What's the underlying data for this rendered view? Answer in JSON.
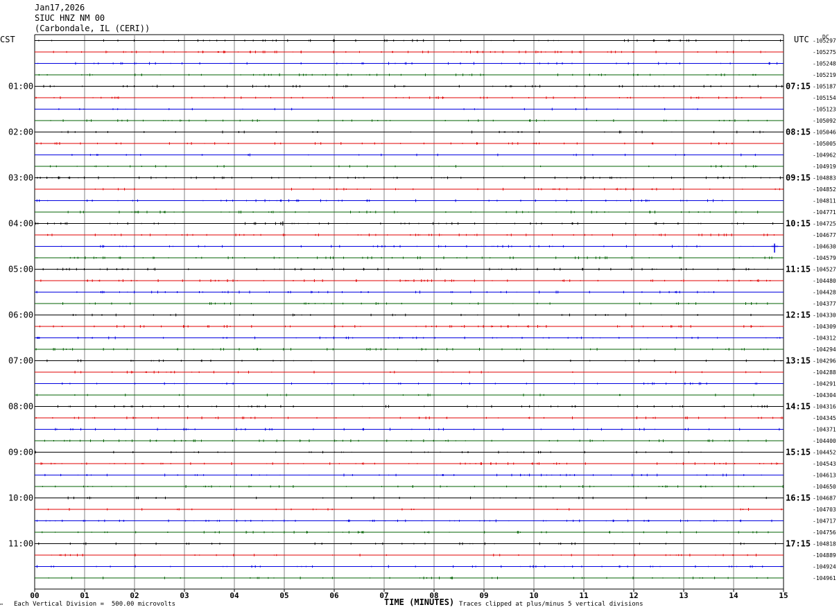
{
  "header": {
    "date": "Jan17,2026",
    "station": "SIUC HNZ NM 00",
    "location": "(Carbondale, IL (CERI))"
  },
  "axis": {
    "left_zone": "CST",
    "right_zone": "UTC",
    "dc_label": "DC",
    "xlabel": "TIME (MINUTES)",
    "x_ticks": [
      "00",
      "01",
      "02",
      "03",
      "04",
      "05",
      "06",
      "07",
      "08",
      "09",
      "10",
      "11",
      "12",
      "13",
      "14",
      "15"
    ],
    "left_hour_labels": [
      "01:00",
      "02:00",
      "03:00",
      "04:00",
      "05:00",
      "06:00",
      "07:00",
      "08:00",
      "09:00",
      "10:00",
      "11:00"
    ],
    "right_hour_labels": [
      "07:15",
      "08:15",
      "09:15",
      "10:15",
      "11:15",
      "12:15",
      "13:15",
      "14:15",
      "15:15",
      "16:15",
      "17:15"
    ]
  },
  "footer": {
    "scale_note": "Each Vertical Division =  500.00 microvolts",
    "clip_note": "Traces clipped at plus/minus 5 vertical divisions",
    "corner_mark": "™"
  },
  "colors": {
    "trace_cycle": [
      "#000000",
      "#e00000",
      "#0000e0",
      "#006000"
    ],
    "grid": "#808080"
  },
  "chart_data": {
    "type": "line",
    "title": "",
    "xlim": [
      0,
      15
    ],
    "trace_count": 48,
    "minutes_per_trace": 15,
    "dc_offsets": [
      "-105297",
      "-105275",
      "-105248",
      "-105219",
      "-105187",
      "-105154",
      "-105123",
      "-105092",
      "-105046",
      "-105005",
      "-104962",
      "-104919",
      "-104883",
      "-104852",
      "-104811",
      "-104771",
      "-104725",
      "-104677",
      "-104630",
      "-104579",
      "-104527",
      "-104480",
      "-104428",
      "-104377",
      "-104330",
      "-104309",
      "-104312",
      "-104294",
      "-104296",
      "-104288",
      "-104291",
      "-104304",
      "-104316",
      "-104345",
      "-104371",
      "-104400",
      "-104452",
      "-104543",
      "-104613",
      "-104650",
      "-104687",
      "-104703",
      "-104717",
      "-104756",
      "-104818",
      "-104889",
      "-104924",
      "-104961"
    ]
  }
}
